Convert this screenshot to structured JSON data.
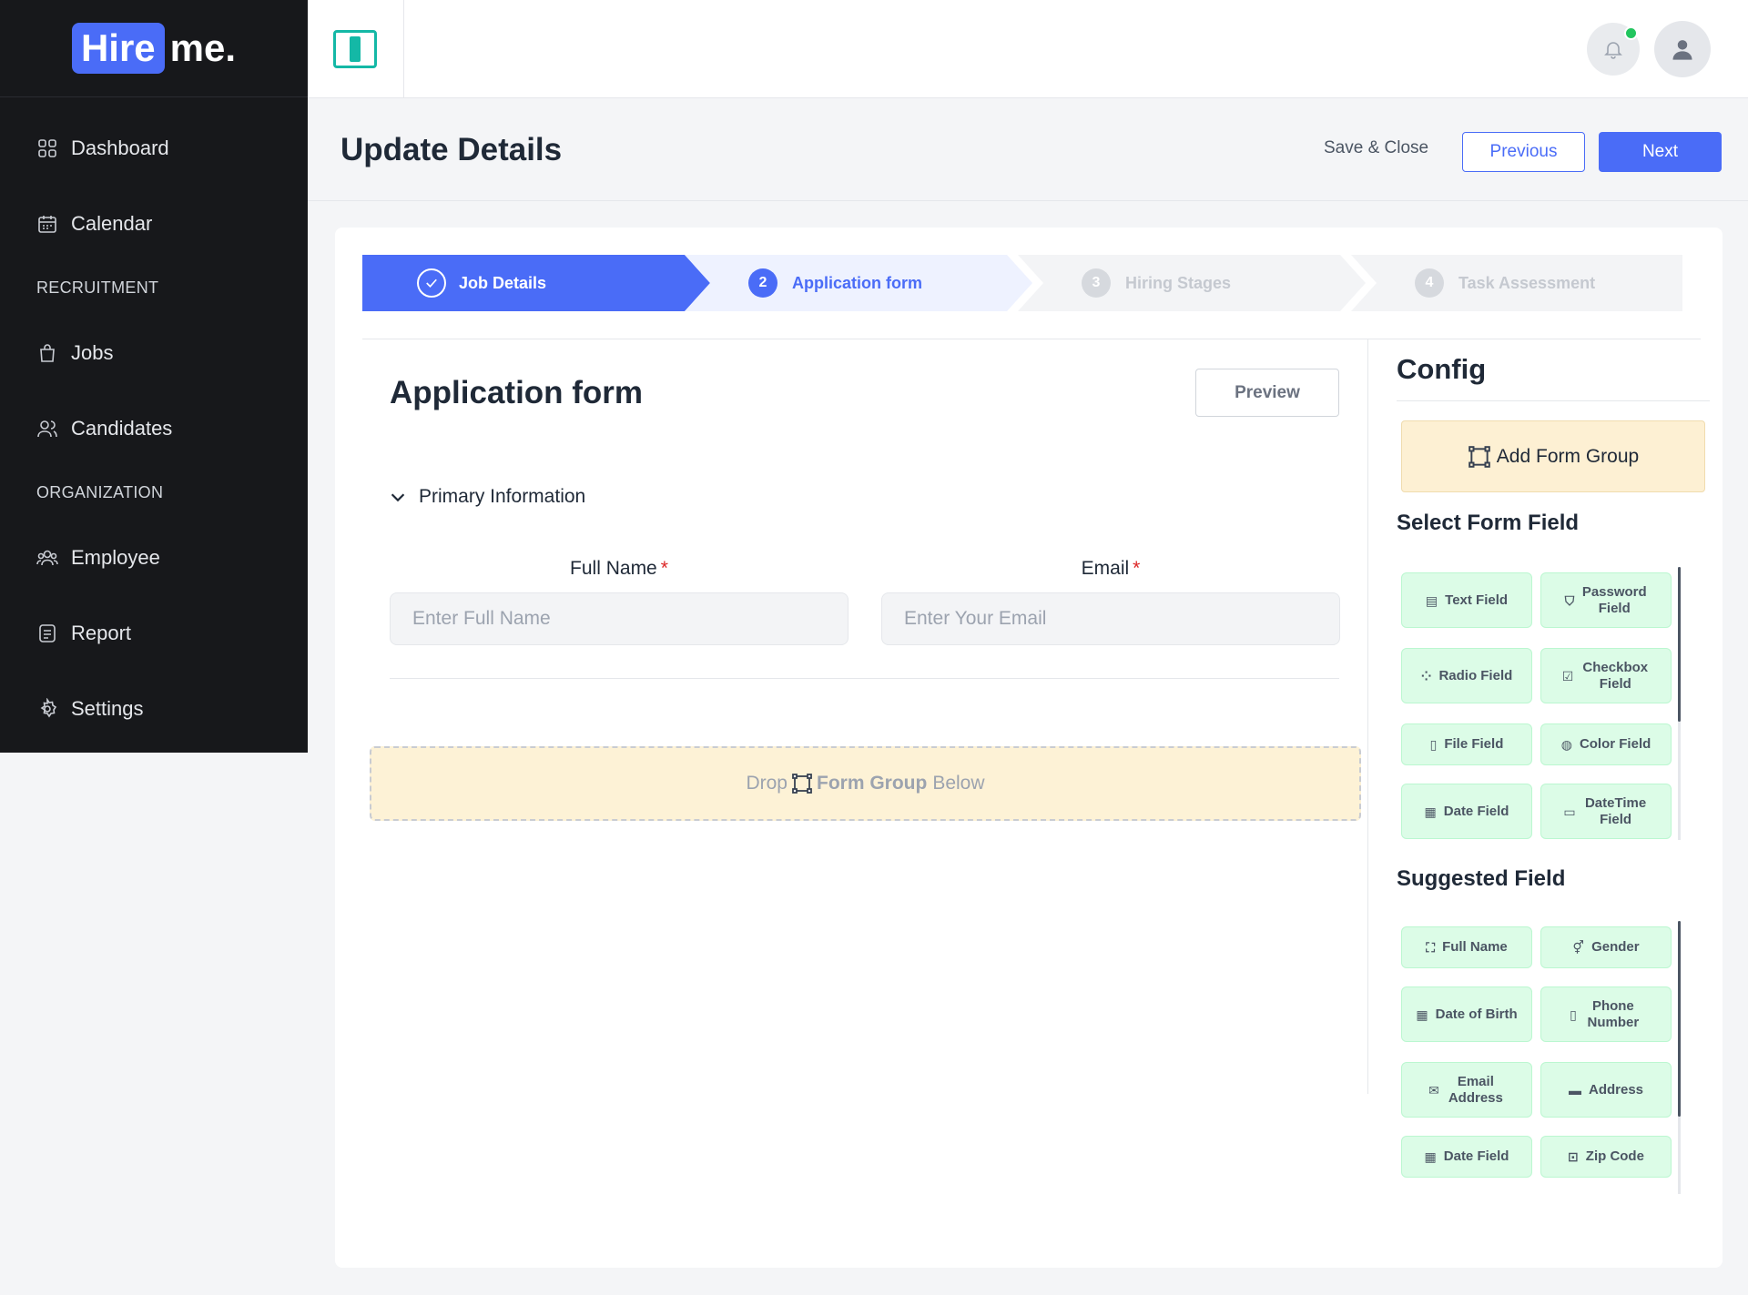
{
  "brand": {
    "logo_part1": "Hire",
    "logo_part2": "me."
  },
  "sidebar": {
    "items": [
      {
        "label": "Dashboard",
        "icon": "grid-icon"
      },
      {
        "label": "Calendar",
        "icon": "calendar-icon"
      }
    ],
    "section_recruitment": "RECRUITMENT",
    "recruitment_items": [
      {
        "label": "Jobs",
        "icon": "bag-icon"
      },
      {
        "label": "Candidates",
        "icon": "users-icon"
      }
    ],
    "section_organization": "ORGANIZATION",
    "organization_items": [
      {
        "label": "Employee",
        "icon": "group-icon"
      },
      {
        "label": "Report",
        "icon": "document-icon"
      },
      {
        "label": "Settings",
        "icon": "gear-icon"
      }
    ]
  },
  "header": {
    "title": "Update Details",
    "save_close": "Save & Close",
    "previous": "Previous",
    "next": "Next"
  },
  "stepper": {
    "steps": [
      {
        "num": "",
        "label": "Job Details",
        "state": "done"
      },
      {
        "num": "2",
        "label": "Application form",
        "state": "active"
      },
      {
        "num": "3",
        "label": "Hiring Stages",
        "state": "pending"
      },
      {
        "num": "4",
        "label": "Task Assessment",
        "state": "pending"
      }
    ]
  },
  "form": {
    "title": "Application form",
    "preview": "Preview",
    "section": "Primary Information",
    "fields": [
      {
        "label": "Full Name",
        "required": "*",
        "placeholder": "Enter Full Name",
        "value": ""
      },
      {
        "label": "Email",
        "required": "*",
        "placeholder": "Enter Your Email",
        "value": ""
      }
    ],
    "drop_zone": {
      "prefix": "Drop",
      "strong": "Form Group",
      "suffix": "Below"
    }
  },
  "config": {
    "title": "Config",
    "add_group": "Add Form Group",
    "select_title": "Select Form Field",
    "select_fields": [
      {
        "label": "Text Field",
        "icon": "▤"
      },
      {
        "label": "Password Field",
        "icon": "⛉"
      },
      {
        "label": "Radio Field",
        "icon": "⁘"
      },
      {
        "label": "Checkbox Field",
        "icon": "☑"
      },
      {
        "label": "File Field",
        "icon": "▯"
      },
      {
        "label": "Color Field",
        "icon": "◍"
      },
      {
        "label": "Date Field",
        "icon": "▦"
      },
      {
        "label": "DateTime Field",
        "icon": "▭"
      }
    ],
    "suggested_title": "Suggested Field",
    "suggested_fields": [
      {
        "label": "Full Name",
        "icon": "⛶"
      },
      {
        "label": "Gender",
        "icon": "⚥"
      },
      {
        "label": "Date of Birth",
        "icon": "▦"
      },
      {
        "label": "Phone Number",
        "icon": "▯"
      },
      {
        "label": "Email Address",
        "icon": "✉"
      },
      {
        "label": "Address",
        "icon": "▬"
      },
      {
        "label": "Date Field",
        "icon": "▦"
      },
      {
        "label": "Zip Code",
        "icon": "⊡"
      }
    ]
  },
  "colors": {
    "accent": "#4a6cf7",
    "sidebar_bg": "#17181b",
    "chip_bg": "#dcfce7",
    "drop_bg": "#fdf2d6",
    "teal": "#14b8a6"
  }
}
